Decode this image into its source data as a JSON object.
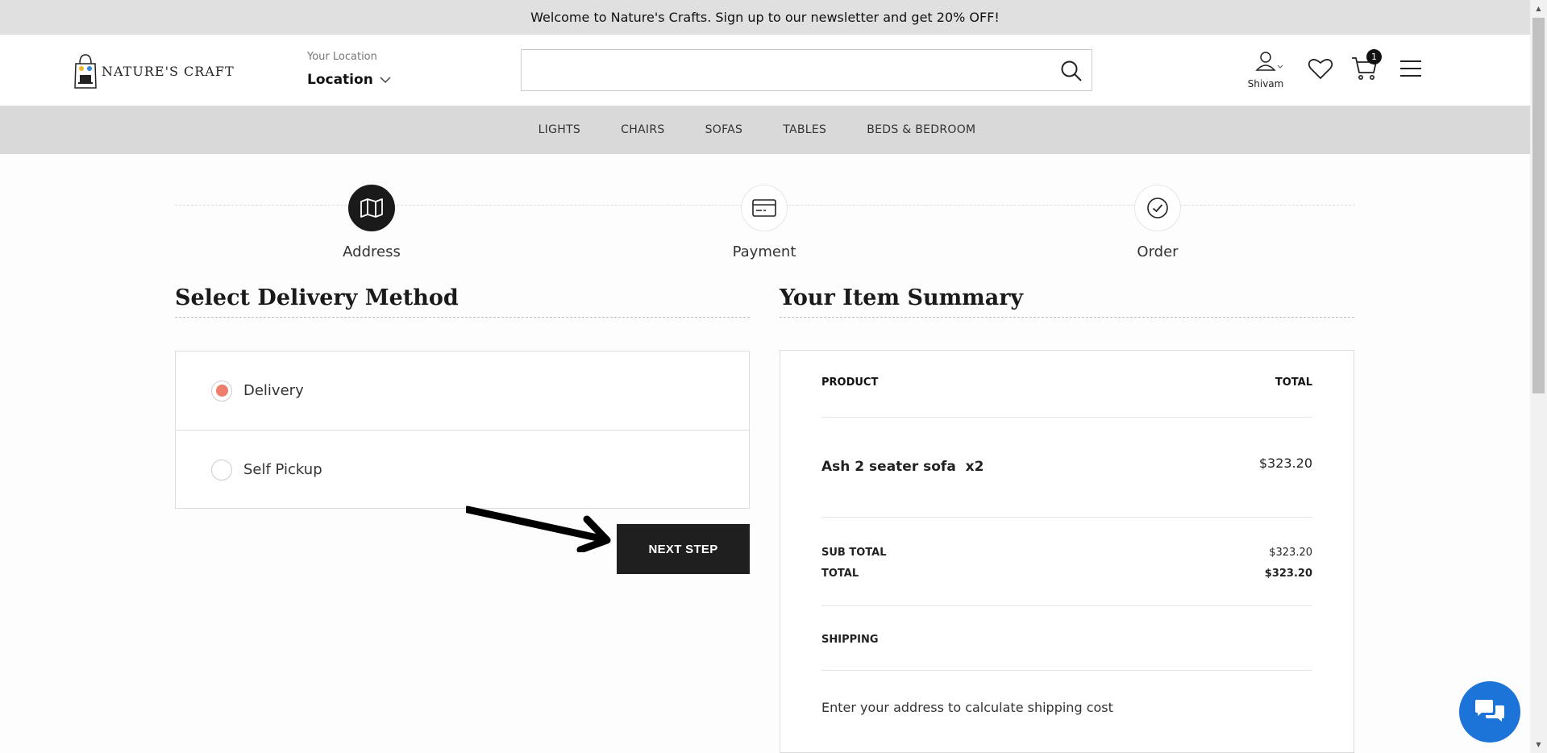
{
  "announcement": "Welcome to Nature's Crafts. Sign up to our newsletter and get 20% OFF!",
  "header": {
    "logo_text": "NATURE'S CRAFT",
    "location_label": "Your Location",
    "location_value": "Location",
    "search_placeholder": "",
    "user_name": "Shivam",
    "cart_count": "1"
  },
  "nav": {
    "items": [
      "LIGHTS",
      "CHAIRS",
      "SOFAS",
      "TABLES",
      "BEDS & BEDROOM"
    ]
  },
  "steps": [
    {
      "label": "Address",
      "icon": "map-icon",
      "active": true
    },
    {
      "label": "Payment",
      "icon": "card-icon",
      "active": false
    },
    {
      "label": "Order",
      "icon": "check-circle-icon",
      "active": false
    }
  ],
  "delivery": {
    "title": "Select Delivery Method",
    "options": [
      {
        "label": "Delivery",
        "selected": true
      },
      {
        "label": "Self Pickup",
        "selected": false
      }
    ],
    "next_label": "NEXT STEP"
  },
  "summary": {
    "title": "Your Item Summary",
    "product_header": "PRODUCT",
    "total_header": "TOTAL",
    "item_name": "Ash 2 seater sofa  x2",
    "item_price": "$323.20",
    "subtotal_label": "SUB TOTAL",
    "subtotal_value": "$323.20",
    "total_label": "TOTAL",
    "total_value": "$323.20",
    "shipping_label": "SHIPPING",
    "shipping_note": "Enter your address to calculate shipping cost"
  },
  "colors": {
    "accent_radio": "#ef7d6c",
    "chat_button": "#1d74d8",
    "dark_button": "#1f1f1f"
  }
}
